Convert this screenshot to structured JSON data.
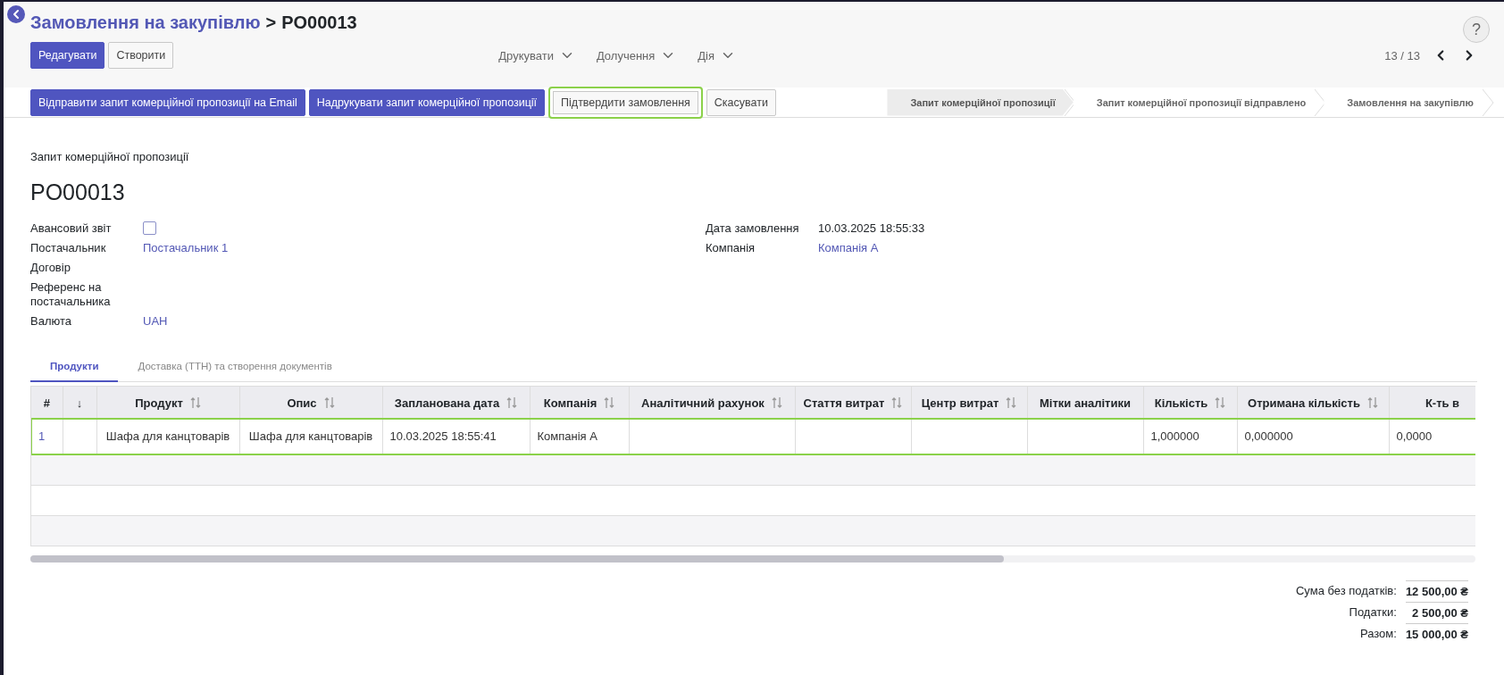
{
  "breadcrumb": {
    "parent": "Замовлення на закупівлю",
    "separator": ">",
    "current": "PO00013"
  },
  "help": "?",
  "main_buttons": [
    {
      "label": "Редагувати",
      "primary": true
    },
    {
      "label": "Створити",
      "primary": false
    }
  ],
  "menus": [
    "Друкувати",
    "Долучення",
    "Дія"
  ],
  "pager": "13 / 13",
  "actions": [
    {
      "label": "Відправити запит комерційної пропозиції на Email",
      "primary": true,
      "highlighted": false
    },
    {
      "label": "Надрукувати запит комерційної пропозиції",
      "primary": true,
      "highlighted": false
    },
    {
      "label": "Підтвердити замовлення",
      "primary": false,
      "highlighted": true
    },
    {
      "label": "Скасувати",
      "primary": false,
      "highlighted": false
    }
  ],
  "status_steps": [
    {
      "label": "Запит комерційної пропозиції",
      "selected": true
    },
    {
      "label": "Запит комерційної пропозиції відправлено",
      "selected": false
    },
    {
      "label": "Замовлення на закупівлю",
      "selected": false
    }
  ],
  "form": {
    "subtitle": "Запит комерційної пропозиції",
    "name": "PO00013",
    "left_fields": [
      {
        "label": "Авансовий звіт",
        "kind": "checkbox",
        "checked": false
      },
      {
        "label": "Постачальник",
        "kind": "link",
        "value": "Постачальник 1"
      },
      {
        "label": "Договір",
        "kind": "empty"
      },
      {
        "label": "Референс на постачальника",
        "kind": "empty"
      },
      {
        "label": "Валюта",
        "kind": "link",
        "value": "UAH"
      }
    ],
    "right_fields": [
      {
        "label": "Дата замовлення",
        "kind": "text",
        "value": "10.03.2025 18:55:33"
      },
      {
        "label": "Компанія",
        "kind": "link",
        "value": "Компанія А"
      }
    ]
  },
  "tabs": [
    {
      "label": "Продукти",
      "selected": true
    },
    {
      "label": "Доставка (ТТН) та створення документів",
      "selected": false
    }
  ],
  "table": {
    "columns": [
      {
        "label": "#",
        "sortable": false
      },
      {
        "label": "↓",
        "sortable": false
      },
      {
        "label": "Продукт",
        "sortable": true
      },
      {
        "label": "Опис",
        "sortable": true
      },
      {
        "label": "Запланована дата",
        "sortable": true
      },
      {
        "label": "Компанія",
        "sortable": true
      },
      {
        "label": "Аналітичний рахунок",
        "sortable": true
      },
      {
        "label": "Стаття витрат",
        "sortable": true
      },
      {
        "label": "Центр витрат",
        "sortable": true
      },
      {
        "label": "Мітки аналітики",
        "sortable": false
      },
      {
        "label": "Кількість",
        "sortable": true
      },
      {
        "label": "Отримана кількість",
        "sortable": true
      },
      {
        "label": "К-ть в",
        "sortable": false
      }
    ],
    "rows": [
      {
        "highlighted": true,
        "cells": [
          "1",
          "",
          "Шафа для канцтоварів",
          "Шафа для канцтоварів",
          "10.03.2025 18:55:41",
          "Компанія А",
          "",
          "",
          "",
          "",
          "1,000000",
          "0,000000",
          "0,0000"
        ]
      }
    ]
  },
  "totals": [
    {
      "label": "Сума без податків:",
      "value": "12 500,00 ₴"
    },
    {
      "label": "Податки:",
      "value": "2 500,00 ₴"
    },
    {
      "label": "Разом:",
      "value": "15 000,00 ₴"
    }
  ]
}
